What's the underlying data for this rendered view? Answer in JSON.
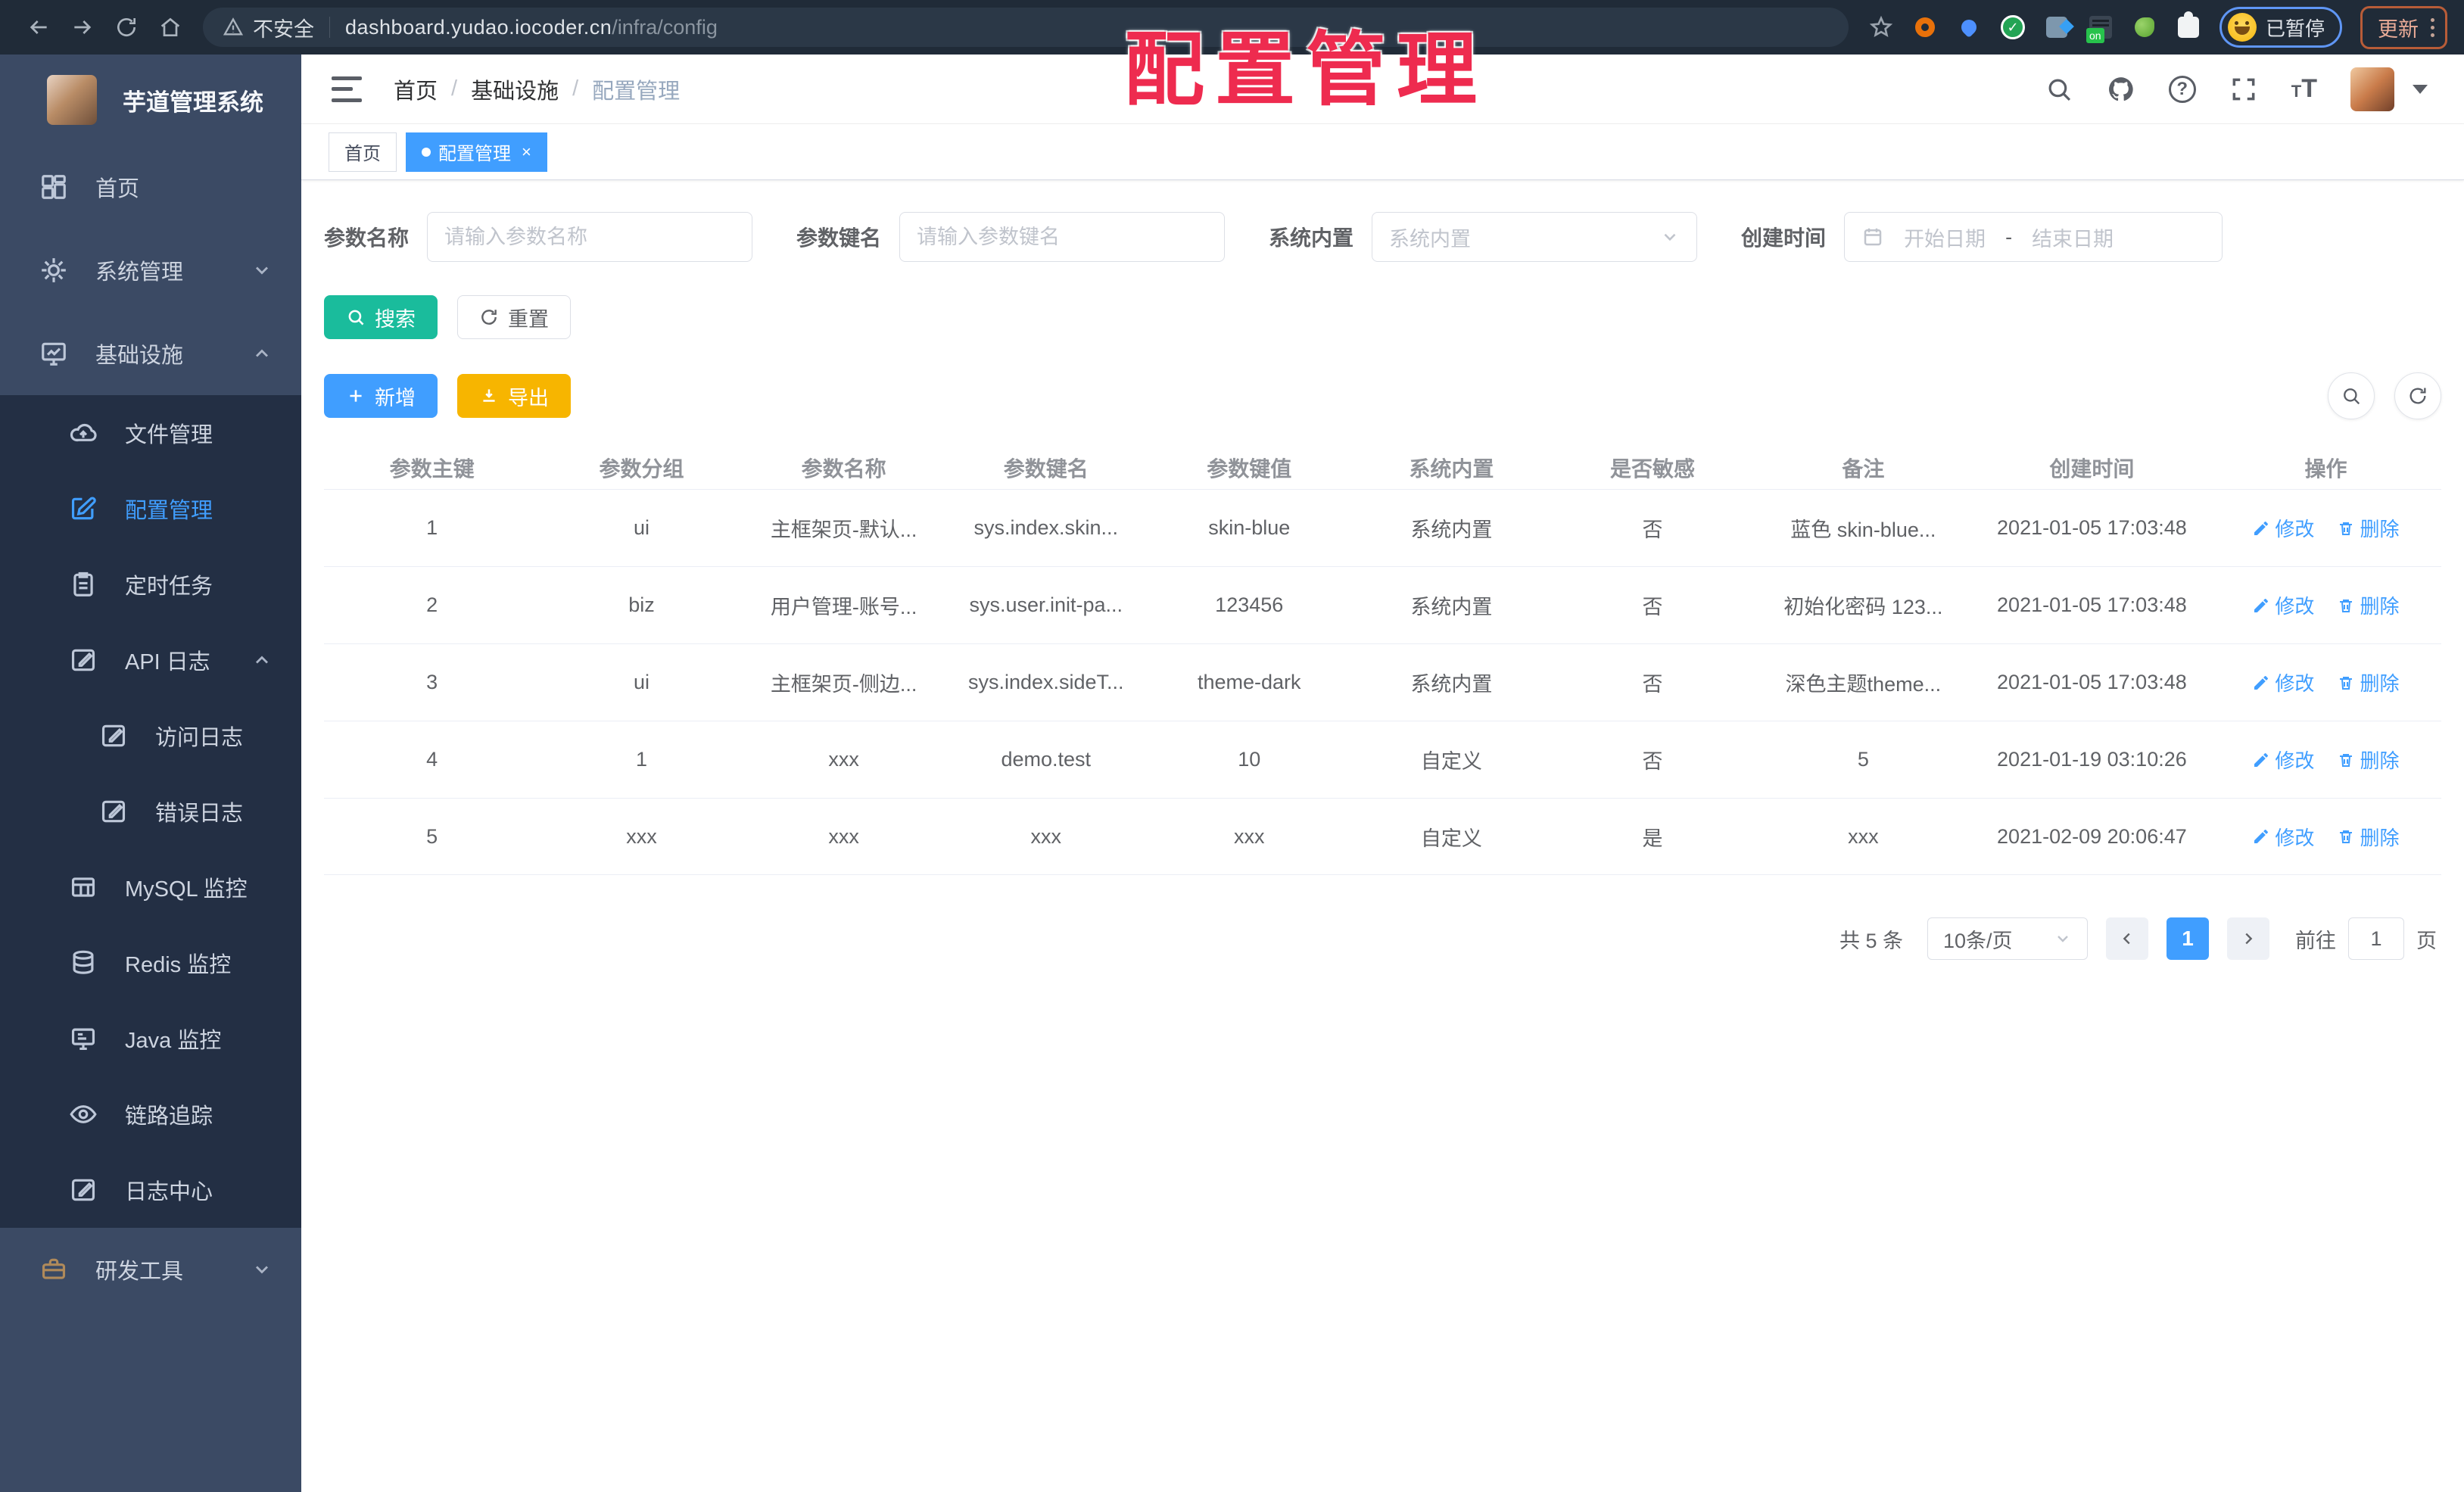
{
  "browser": {
    "security_label": "不安全",
    "url_host": "dashboard.yudao.iocoder.cn",
    "url_path": "/infra/config",
    "paused_badge": "已暂停",
    "update_button": "更新"
  },
  "overlay_title": "配置管理",
  "sidebar": {
    "title": "芋道管理系统",
    "items": [
      {
        "label": "首页"
      },
      {
        "label": "系统管理"
      },
      {
        "label": "基础设施"
      },
      {
        "label": "文件管理"
      },
      {
        "label": "配置管理"
      },
      {
        "label": "定时任务"
      },
      {
        "label": "API 日志"
      },
      {
        "label": "访问日志"
      },
      {
        "label": "错误日志"
      },
      {
        "label": "MySQL 监控"
      },
      {
        "label": "Redis 监控"
      },
      {
        "label": "Java 监控"
      },
      {
        "label": "链路追踪"
      },
      {
        "label": "日志中心"
      },
      {
        "label": "研发工具"
      }
    ]
  },
  "header": {
    "breadcrumb": [
      "首页",
      "基础设施",
      "配置管理"
    ],
    "separator": "/"
  },
  "tabs": [
    {
      "label": "首页"
    },
    {
      "label": "配置管理"
    }
  ],
  "filters": {
    "name_label": "参数名称",
    "name_placeholder": "请输入参数名称",
    "key_label": "参数键名",
    "key_placeholder": "请输入参数键名",
    "type_label": "系统内置",
    "type_placeholder": "系统内置",
    "date_label": "创建时间",
    "date_start": "开始日期",
    "date_separator": "-",
    "date_end": "结束日期"
  },
  "toolbar": {
    "search": "搜索",
    "reset": "重置",
    "add": "新增",
    "export": "导出"
  },
  "table": {
    "columns": [
      "参数主键",
      "参数分组",
      "参数名称",
      "参数键名",
      "参数键值",
      "系统内置",
      "是否敏感",
      "备注",
      "创建时间",
      "操作"
    ],
    "edit_label": "修改",
    "delete_label": "删除",
    "rows": [
      {
        "cells": [
          "1",
          "ui",
          "主框架页-默认...",
          "sys.index.skin...",
          "skin-blue",
          "系统内置",
          "否",
          "蓝色 skin-blue...",
          "2021-01-05 17:03:48"
        ]
      },
      {
        "cells": [
          "2",
          "biz",
          "用户管理-账号...",
          "sys.user.init-pa...",
          "123456",
          "系统内置",
          "否",
          "初始化密码 123...",
          "2021-01-05 17:03:48"
        ]
      },
      {
        "cells": [
          "3",
          "ui",
          "主框架页-侧边...",
          "sys.index.sideT...",
          "theme-dark",
          "系统内置",
          "否",
          "深色主题theme...",
          "2021-01-05 17:03:48"
        ]
      },
      {
        "cells": [
          "4",
          "1",
          "xxx",
          "demo.test",
          "10",
          "自定义",
          "否",
          "5",
          "2021-01-19 03:10:26"
        ]
      },
      {
        "cells": [
          "5",
          "xxx",
          "xxx",
          "xxx",
          "xxx",
          "自定义",
          "是",
          "xxx",
          "2021-02-09 20:06:47"
        ]
      }
    ]
  },
  "pagination": {
    "total": "共 5 条",
    "page_size": "10条/页",
    "current_page": "1",
    "goto_label": "前往",
    "goto_value": "1",
    "page_unit": "页"
  },
  "colors": {
    "accent_blue": "#409eff",
    "search_teal": "#1abc9c",
    "export_amber": "#f7b500",
    "overlay_red": "#ee2b4f",
    "sidebar_bg": "#3b4a64",
    "submenu_bg": "#232f44"
  }
}
